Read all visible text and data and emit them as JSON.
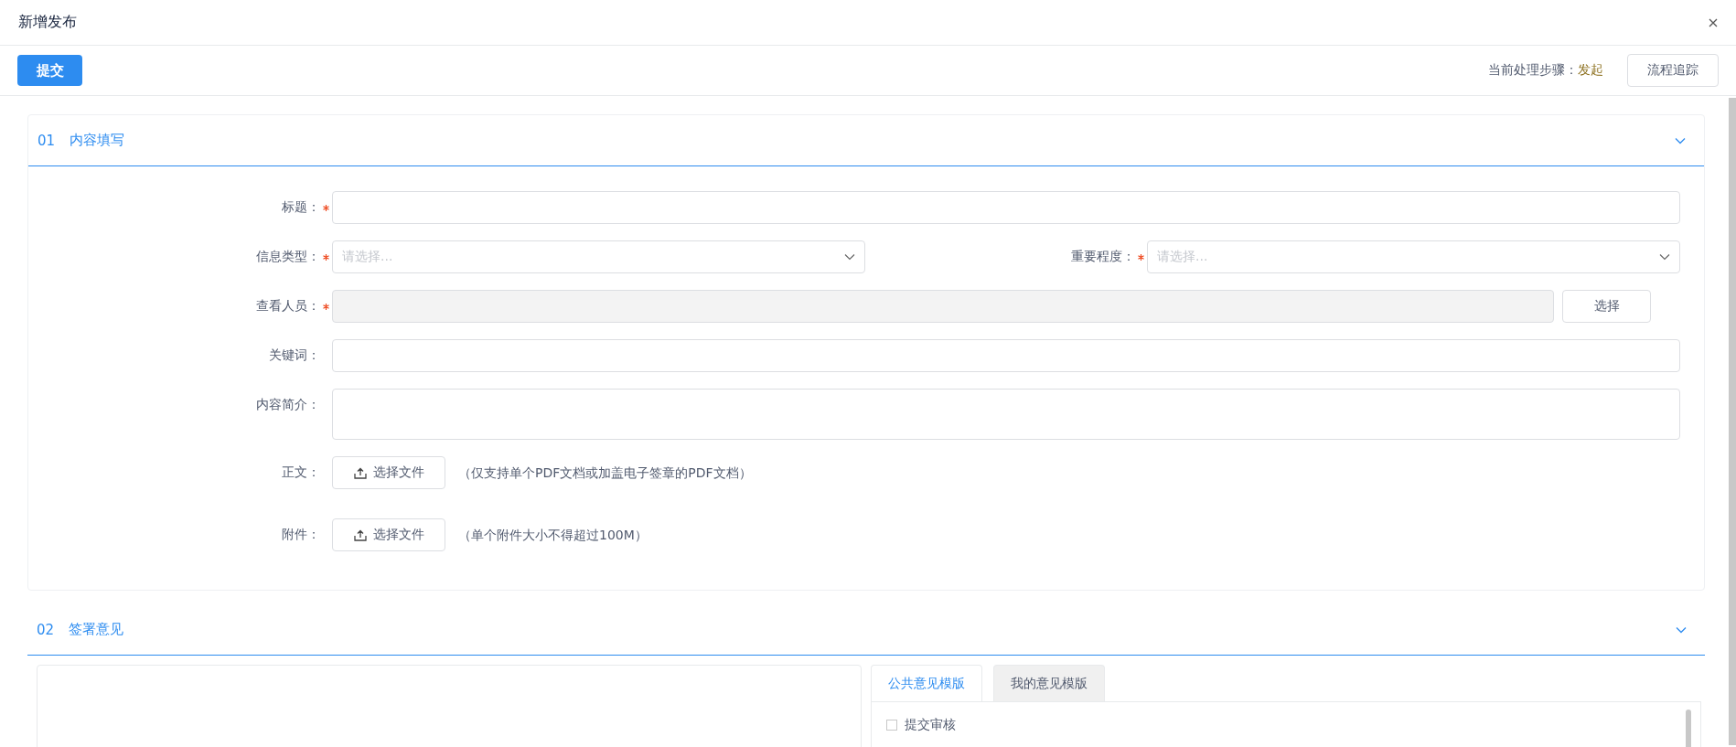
{
  "window": {
    "title": "新增发布"
  },
  "toolbar": {
    "submit": "提交",
    "step_label": "当前处理步骤：",
    "step_value": "发起",
    "trace": "流程追踪"
  },
  "sections": [
    {
      "number": "01",
      "title": "内容填写"
    },
    {
      "number": "02",
      "title": "签署意见"
    }
  ],
  "form": {
    "rows": [
      {
        "fields": [
          {
            "kind": "text",
            "label": "标题：",
            "required": true
          }
        ]
      },
      {
        "fields": [
          {
            "kind": "select",
            "label": "信息类型：",
            "required": true,
            "placeholder": "请选择..."
          },
          {
            "kind": "select",
            "label": "重要程度：",
            "required": true,
            "placeholder": "请选择..."
          }
        ]
      },
      {
        "fields": [
          {
            "kind": "picker",
            "label": "查看人员：",
            "required": true,
            "disabled": true,
            "button": "选择"
          }
        ]
      },
      {
        "fields": [
          {
            "kind": "text",
            "label": "关键词：",
            "required": false
          }
        ]
      },
      {
        "fields": [
          {
            "kind": "textarea",
            "label": "内容简介：",
            "required": false
          }
        ]
      },
      {
        "fields": [
          {
            "kind": "file",
            "label": "正文：",
            "required": false,
            "button": "选择文件",
            "hint": "（仅支持单个PDF文档或加盖电子签章的PDF文档）"
          }
        ]
      },
      {
        "fields": [
          {
            "kind": "file",
            "label": "附件：",
            "required": false,
            "button": "选择文件",
            "hint": "（单个附件大小不得超过100M）"
          }
        ]
      }
    ]
  },
  "opinion": {
    "tabs": [
      {
        "label": "公共意见模版",
        "selected": true
      },
      {
        "label": "我的意见模版",
        "selected": false
      }
    ],
    "items": [
      {
        "label": "提交审核",
        "checked": false
      }
    ]
  }
}
